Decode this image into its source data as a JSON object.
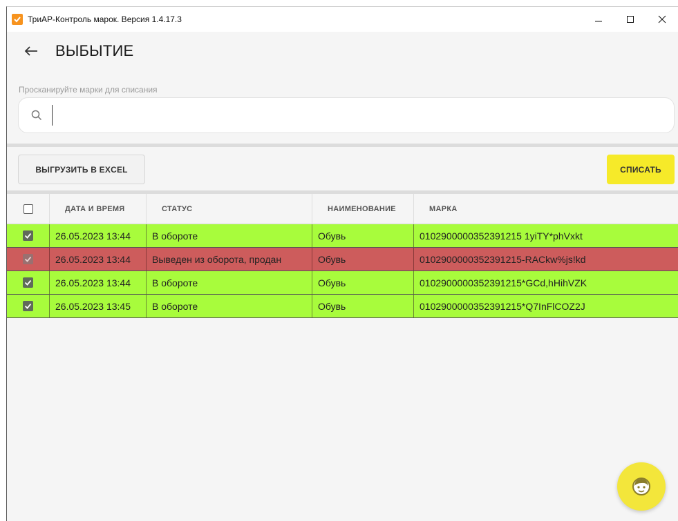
{
  "window": {
    "title": "ТриАР-Контроль марок. Версия 1.4.17.3",
    "controls": [
      "minimize-icon",
      "maximize-icon",
      "close-icon"
    ]
  },
  "header": {
    "title": "ВЫБЫТИЕ"
  },
  "search": {
    "label": "Просканируйте марки для списания",
    "value": ""
  },
  "toolbar": {
    "export_label": "ВЫГРУЗИТЬ В EXCEL",
    "write_off_label": "СПИСАТЬ"
  },
  "table": {
    "columns": [
      "ДАТА И ВРЕМЯ",
      "СТАТУС",
      "НАИМЕНОВАНИЕ",
      "МАРКА"
    ],
    "rows": [
      {
        "datetime": "26.05.2023 13:44",
        "status": "В обороте",
        "name": "Обувь",
        "mark": "0102900000352391215 1yiTY*phVxkt",
        "state": "ok",
        "checked": true
      },
      {
        "datetime": "26.05.2023 13:44",
        "status": "Выведен из оборота, продан",
        "name": "Обувь",
        "mark": "0102900000352391215-RACkw%js!kd",
        "state": "error",
        "checked": true
      },
      {
        "datetime": "26.05.2023 13:44",
        "status": "В обороте",
        "name": "Обувь",
        "mark": "0102900000352391215*GCd,hHihVZK",
        "state": "ok",
        "checked": true
      },
      {
        "datetime": "26.05.2023 13:45",
        "status": "В обороте",
        "name": "Обувь",
        "mark": "0102900000352391215*Q7InFlCOZ2J",
        "state": "ok",
        "checked": true
      }
    ]
  },
  "colors": {
    "ok_row": "#a8fc3c",
    "error_row": "#cd5c5c",
    "accent": "#f6ea29"
  }
}
